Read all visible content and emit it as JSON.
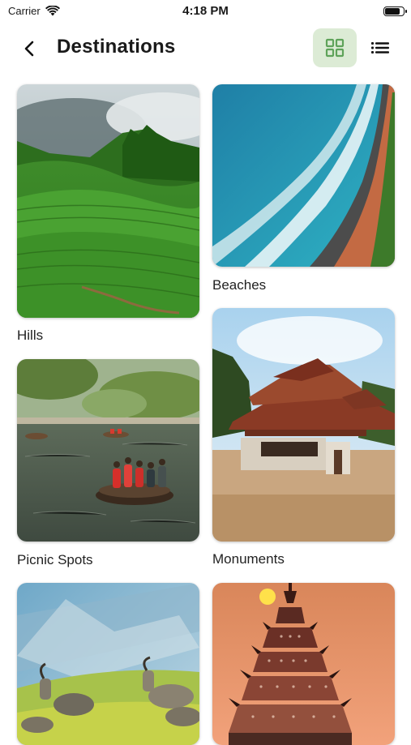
{
  "status": {
    "carrier": "Carrier",
    "time": "4:18 PM",
    "battery_level": 0.9
  },
  "header": {
    "title": "Destinations"
  },
  "categories": [
    {
      "label": "Hills"
    },
    {
      "label": "Beaches"
    },
    {
      "label": "Picnic Spots"
    },
    {
      "label": "Monuments"
    },
    {
      "label": "",
      "image": "wildlife"
    },
    {
      "label": "",
      "image": "temple"
    }
  ],
  "colors": {
    "accent": "#5fa35a",
    "toggle_bg": "#dcebd5"
  }
}
